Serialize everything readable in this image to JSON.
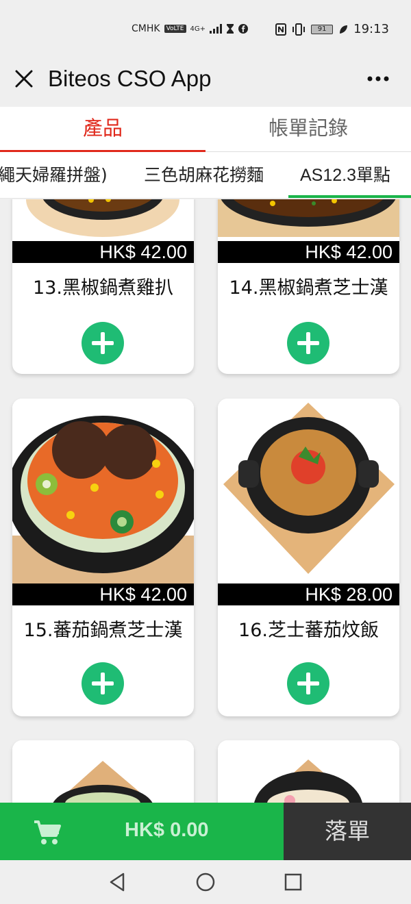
{
  "status_bar": {
    "carrier": "CMHK",
    "volte": "VoLTE",
    "network": "4G+",
    "battery": "91",
    "time": "19:13"
  },
  "app_bar": {
    "title": "Biteos CSO App"
  },
  "main_tabs": [
    {
      "label": "產品",
      "active": true
    },
    {
      "label": "帳單記錄",
      "active": false
    }
  ],
  "category_tabs": [
    {
      "label": "繩天婦羅拼盤)"
    },
    {
      "label": "三色胡麻花撈麵"
    },
    {
      "label": "AS12.3單點",
      "active": true
    }
  ],
  "products": [
    {
      "name": "13.黑椒鍋煮雞扒",
      "price": "HK$ 42.00"
    },
    {
      "name": "14.黑椒鍋煮芝士漢",
      "price": "HK$ 42.00"
    },
    {
      "name": "15.蕃茄鍋煮芝士漢",
      "price": "HK$ 42.00"
    },
    {
      "name": "16.芝士蕃茄炆飯",
      "price": "HK$ 28.00"
    }
  ],
  "cart": {
    "total": "HK$ 0.00",
    "submit_label": "落單"
  },
  "colors": {
    "accent_red": "#e0291c",
    "green": "#1ab54a",
    "add_green": "#1fbc74"
  }
}
